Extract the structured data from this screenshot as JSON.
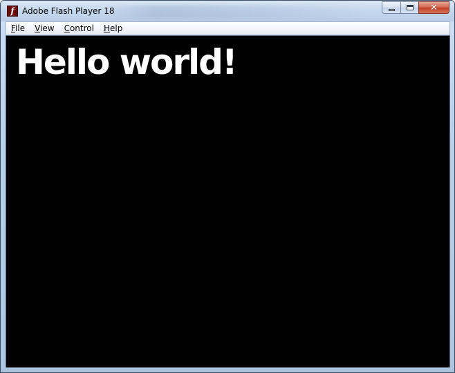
{
  "window": {
    "title": "Adobe Flash Player 18",
    "app_icon": "flash-icon",
    "app_icon_glyph": "f",
    "caption": {
      "minimize_icon": "minimize-icon",
      "maximize_icon": "maximize-icon",
      "close_icon": "close-icon",
      "close_glyph": "✕"
    }
  },
  "menu": {
    "items": [
      {
        "mnemonic": "F",
        "rest": "ile"
      },
      {
        "mnemonic": "V",
        "rest": "iew"
      },
      {
        "mnemonic": "C",
        "rest": "ontrol"
      },
      {
        "mnemonic": "H",
        "rest": "elp"
      }
    ]
  },
  "stage": {
    "text": "Hello world!",
    "background": "#000000",
    "text_color": "#ffffff"
  }
}
